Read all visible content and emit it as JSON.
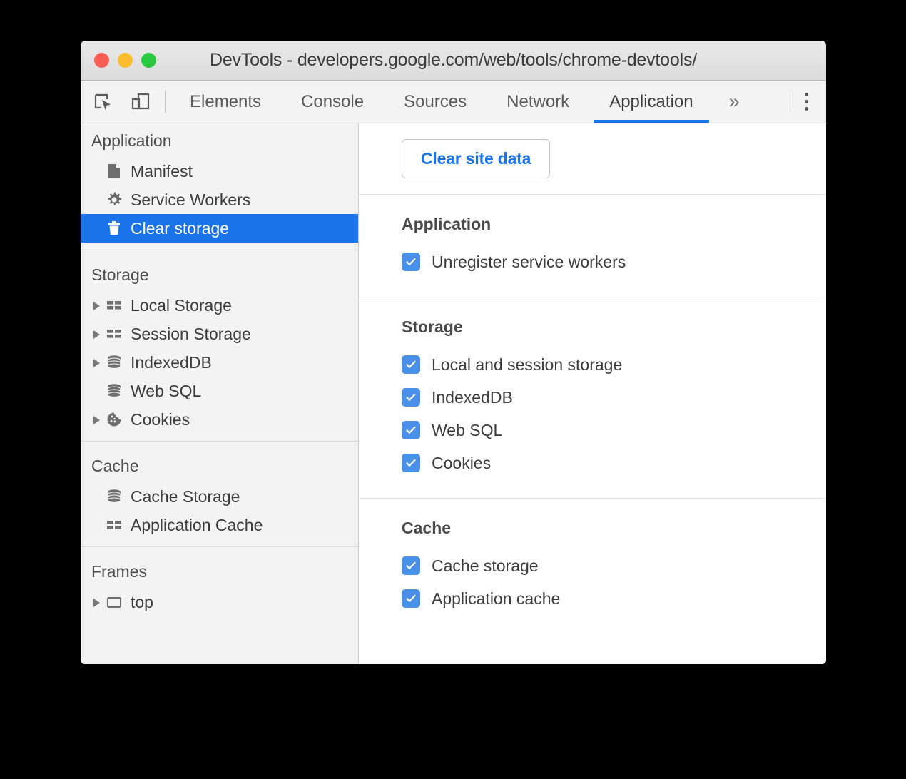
{
  "window": {
    "title": "DevTools - developers.google.com/web/tools/chrome-devtools/",
    "traffic_lights": [
      "close",
      "minimize",
      "maximize"
    ]
  },
  "toolbar": {
    "icons": [
      {
        "name": "inspect-element-icon",
        "label": "Inspect element"
      },
      {
        "name": "device-toolbar-icon",
        "label": "Toggle device toolbar"
      }
    ],
    "tabs": [
      {
        "label": "Elements",
        "active": false
      },
      {
        "label": "Console",
        "active": false
      },
      {
        "label": "Sources",
        "active": false
      },
      {
        "label": "Network",
        "active": false
      },
      {
        "label": "Application",
        "active": true
      }
    ],
    "more_tabs_label": "»",
    "menu_label": "Customize and control DevTools"
  },
  "sidebar": {
    "sections": [
      {
        "title": "Application",
        "items": [
          {
            "label": "Manifest",
            "icon": "document-icon",
            "expandable": false,
            "selected": false
          },
          {
            "label": "Service Workers",
            "icon": "gear-icon",
            "expandable": false,
            "selected": false
          },
          {
            "label": "Clear storage",
            "icon": "trash-icon",
            "expandable": false,
            "selected": true
          }
        ]
      },
      {
        "title": "Storage",
        "items": [
          {
            "label": "Local Storage",
            "icon": "table-icon",
            "expandable": true,
            "selected": false
          },
          {
            "label": "Session Storage",
            "icon": "table-icon",
            "expandable": true,
            "selected": false
          },
          {
            "label": "IndexedDB",
            "icon": "database-icon",
            "expandable": true,
            "selected": false
          },
          {
            "label": "Web SQL",
            "icon": "database-icon",
            "expandable": false,
            "selected": false
          },
          {
            "label": "Cookies",
            "icon": "cookie-icon",
            "expandable": true,
            "selected": false
          }
        ]
      },
      {
        "title": "Cache",
        "items": [
          {
            "label": "Cache Storage",
            "icon": "database-icon",
            "expandable": false,
            "selected": false
          },
          {
            "label": "Application Cache",
            "icon": "table-icon",
            "expandable": false,
            "selected": false
          }
        ]
      },
      {
        "title": "Frames",
        "items": [
          {
            "label": "top",
            "icon": "frame-icon",
            "expandable": true,
            "selected": false
          }
        ]
      }
    ]
  },
  "main": {
    "clear_site_data_label": "Clear site data",
    "groups": [
      {
        "title": "Application",
        "options": [
          {
            "label": "Unregister service workers",
            "checked": true
          }
        ]
      },
      {
        "title": "Storage",
        "options": [
          {
            "label": "Local and session storage",
            "checked": true
          },
          {
            "label": "IndexedDB",
            "checked": true
          },
          {
            "label": "Web SQL",
            "checked": true
          },
          {
            "label": "Cookies",
            "checked": true
          }
        ]
      },
      {
        "title": "Cache",
        "options": [
          {
            "label": "Cache storage",
            "checked": true
          },
          {
            "label": "Application cache",
            "checked": true
          }
        ]
      }
    ]
  },
  "colors": {
    "accent_blue": "#1a73e8",
    "checkbox_blue": "#4a90e8",
    "sidebar_bg": "#f3f3f3",
    "titlebar_bg": "#e4e4e4",
    "light_red": "#fc5d55",
    "light_yellow": "#f9bd2e",
    "light_green": "#28c840"
  }
}
